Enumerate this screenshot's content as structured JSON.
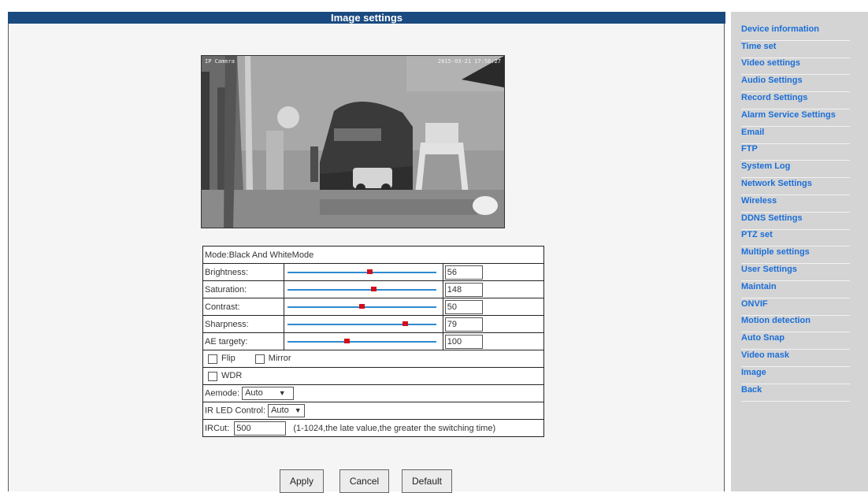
{
  "header": {
    "title": "Image settings"
  },
  "camera": {
    "label": "IP Camera",
    "timestamp": "2015-03-21 17:56:27"
  },
  "settings": {
    "mode": "Mode:Black And WhiteMode",
    "sliders": [
      {
        "label": "Brightness:",
        "value": "56",
        "fraction": 0.55
      },
      {
        "label": "Saturation:",
        "value": "148",
        "fraction": 0.58
      },
      {
        "label": "Contrast:",
        "value": "50",
        "fraction": 0.5
      },
      {
        "label": "Sharpness:",
        "value": "79",
        "fraction": 0.79
      },
      {
        "label": "AE targety:",
        "value": "100",
        "fraction": 0.4
      }
    ],
    "flip_label": "Flip",
    "mirror_label": "Mirror",
    "wdr_label": "WDR",
    "aemode_label": "Aemode:",
    "aemode_value": "Auto",
    "irled_label": "IR LED Control:",
    "irled_value": "Auto",
    "ircut_label": "IRCut:",
    "ircut_value": "500",
    "ircut_hint": "(1-1024,the late value,the greater the switching time)"
  },
  "buttons": {
    "apply": "Apply",
    "cancel": "Cancel",
    "default": "Default"
  },
  "sidebar": {
    "items": [
      "Device information",
      "Time set",
      "Video settings",
      "Audio Settings",
      "Record Settings",
      "Alarm Service Settings",
      "Email",
      "FTP",
      "System Log",
      "Network Settings",
      "Wireless",
      "DDNS Settings",
      "PTZ set",
      "Multiple settings",
      "User Settings",
      "Maintain",
      "ONVIF",
      "Motion detection",
      "Auto Snap",
      "Video mask",
      "Image",
      "Back"
    ]
  },
  "colors": {
    "title_bar": "#1a4a80",
    "link": "#1a6ed8",
    "slider_track": "#2f8ad0",
    "slider_thumb": "#d0101b",
    "sidebar_bg": "#d4d4d4"
  }
}
